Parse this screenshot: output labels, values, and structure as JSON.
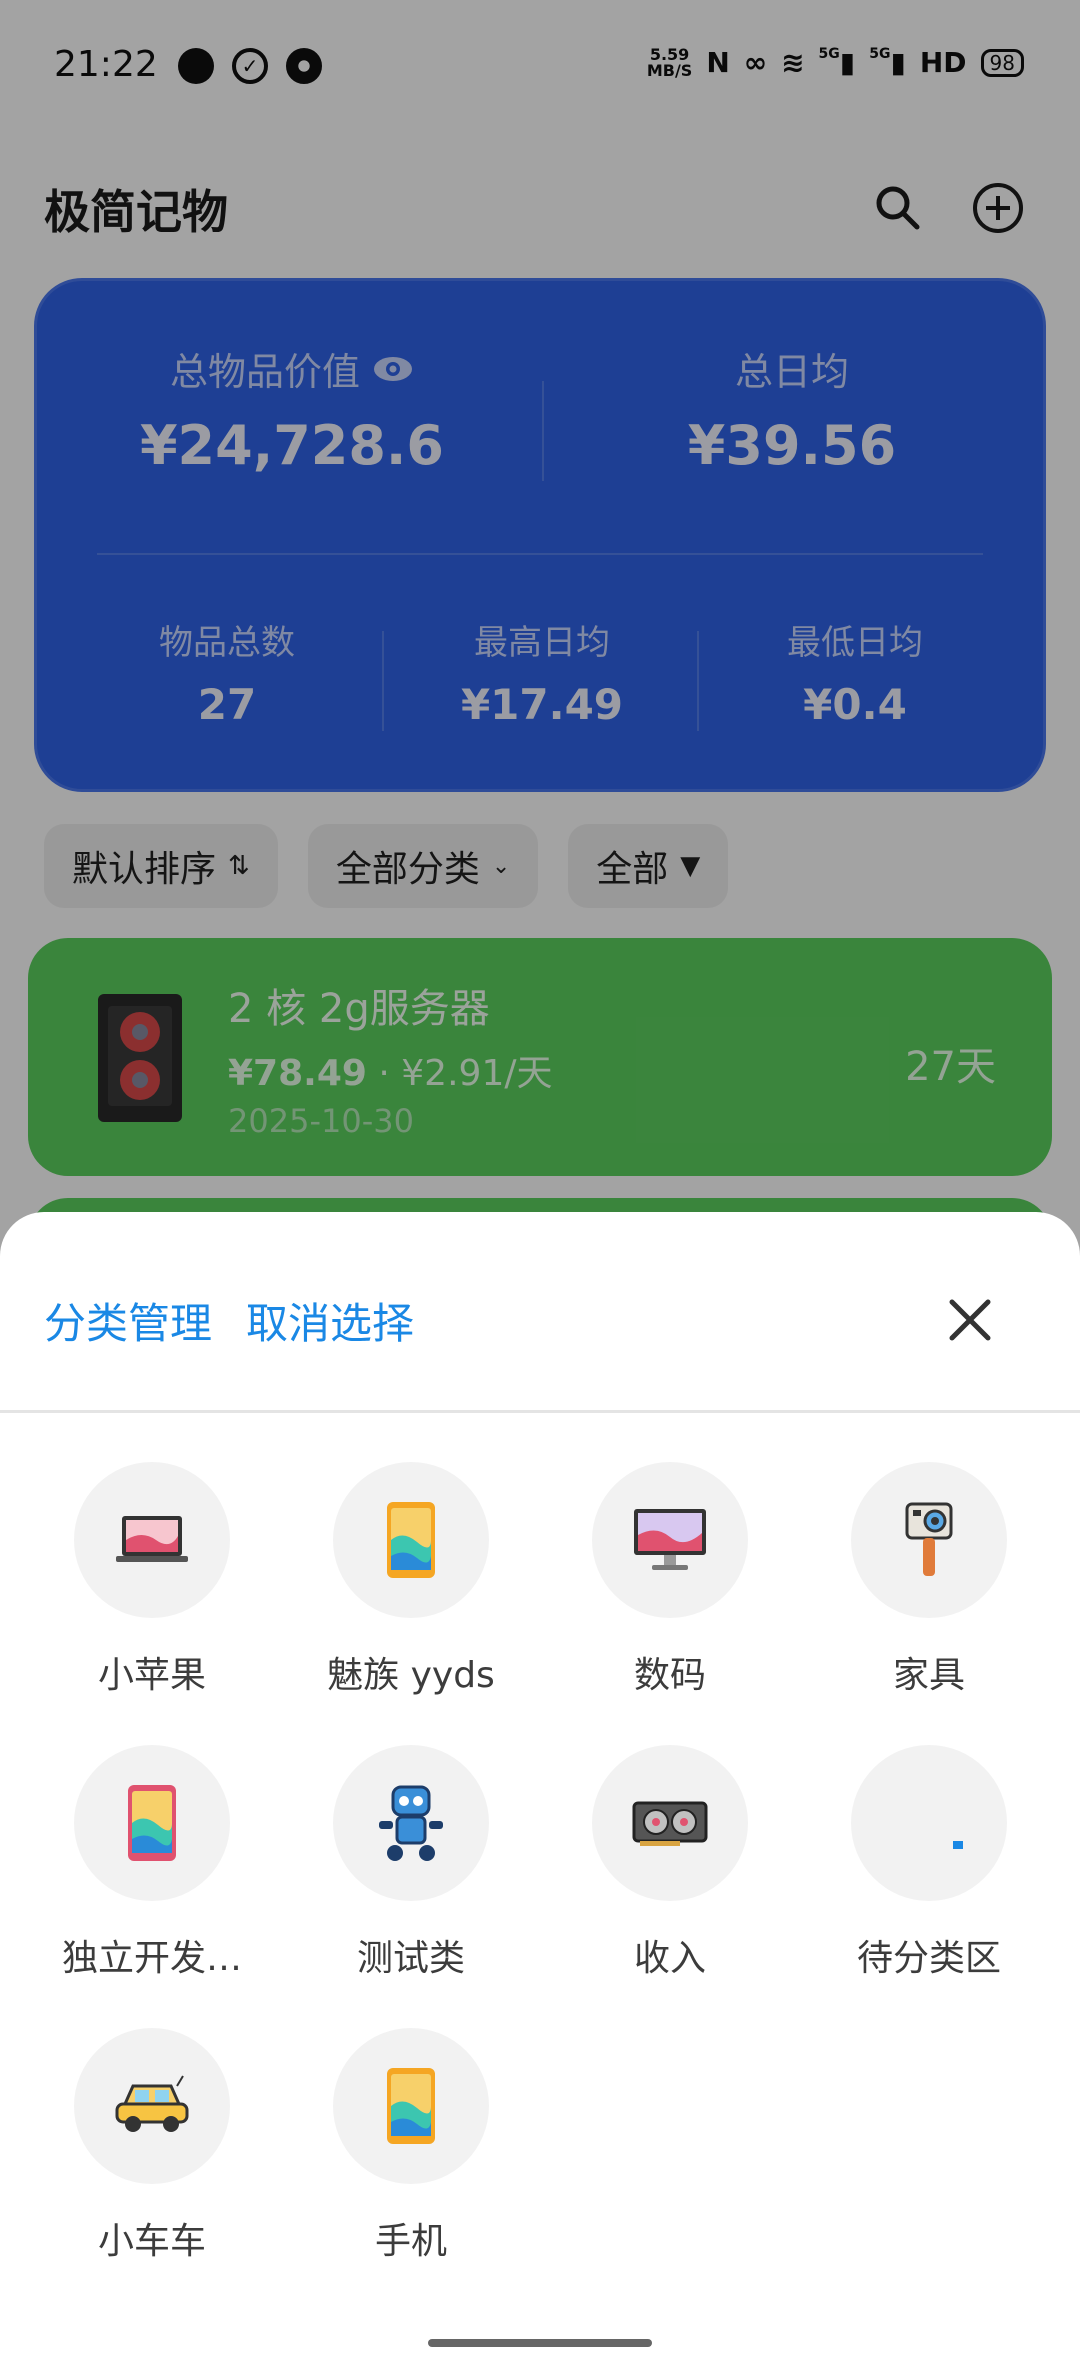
{
  "status_bar": {
    "time": "21:22",
    "net_speed_value": "5.59",
    "net_speed_unit": "MB/S",
    "network": "5G",
    "network2": "5G",
    "hd": "HD",
    "battery": "98"
  },
  "header": {
    "title": "极简记物",
    "search_icon": "search-icon",
    "add_icon": "add-circle-icon"
  },
  "summary": {
    "total_value_label": "总物品价值",
    "total_value": "¥24,728.6",
    "daily_avg_label": "总日均",
    "daily_avg": "¥39.56",
    "item_count_label": "物品总数",
    "item_count": "27",
    "max_daily_label": "最高日均",
    "max_daily": "¥17.49",
    "min_daily_label": "最低日均",
    "min_daily": "¥0.4"
  },
  "filters": {
    "sort_label": "默认排序",
    "category_label": "全部分类",
    "status_label": "全部"
  },
  "item": {
    "name": "2 核 2g服务器",
    "price": "¥78.49",
    "separator": "·",
    "daily": "¥2.91/天",
    "date": "2025-10-30",
    "days": "27天"
  },
  "sheet": {
    "manage_label": "分类管理",
    "cancel_label": "取消选择",
    "close_icon": "close-icon",
    "categories": [
      {
        "label": "小苹果",
        "icon": "laptop-icon"
      },
      {
        "label": "魅族 yyds",
        "icon": "phone-icon"
      },
      {
        "label": "数码",
        "icon": "monitor-icon"
      },
      {
        "label": "家具",
        "icon": "action-camera-icon"
      },
      {
        "label": "独立开发…",
        "icon": "phone-icon"
      },
      {
        "label": "测试类",
        "icon": "robot-icon"
      },
      {
        "label": "收入",
        "icon": "graphics-card-icon"
      },
      {
        "label": "待分类区",
        "icon": "dot-icon"
      },
      {
        "label": "小车车",
        "icon": "car-icon"
      },
      {
        "label": "手机",
        "icon": "phone-icon"
      }
    ]
  },
  "colors": {
    "summary_card": "#2f63e8",
    "item_card": "#5cd05f",
    "link": "#1a88e5"
  }
}
